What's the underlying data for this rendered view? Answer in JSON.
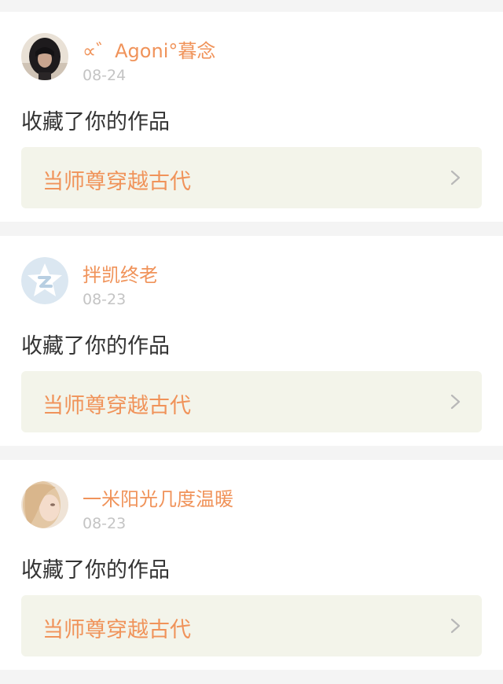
{
  "feed": [
    {
      "user": "∝゛Agoni°暮念",
      "date": "08-24",
      "action": "收藏了你的作品",
      "work_title": "当师尊穿越古代",
      "avatar": "dark-hair-photo"
    },
    {
      "user": "拌凯终老",
      "date": "08-23",
      "action": "收藏了你的作品",
      "work_title": "当师尊穿越古代",
      "avatar": "default-star-avatar"
    },
    {
      "user": "一米阳光几度温暖",
      "date": "08-23",
      "action": "收藏了你的作品",
      "work_title": "当师尊穿越古代",
      "avatar": "blonde-hair-photo"
    }
  ],
  "colors": {
    "accent": "#f0935a",
    "date": "#c4c4c4",
    "text": "#333333",
    "link_bg": "#f3f4ea",
    "page_bg": "#f4f4f4"
  },
  "icons": {
    "chevron": "chevron-right-icon"
  }
}
